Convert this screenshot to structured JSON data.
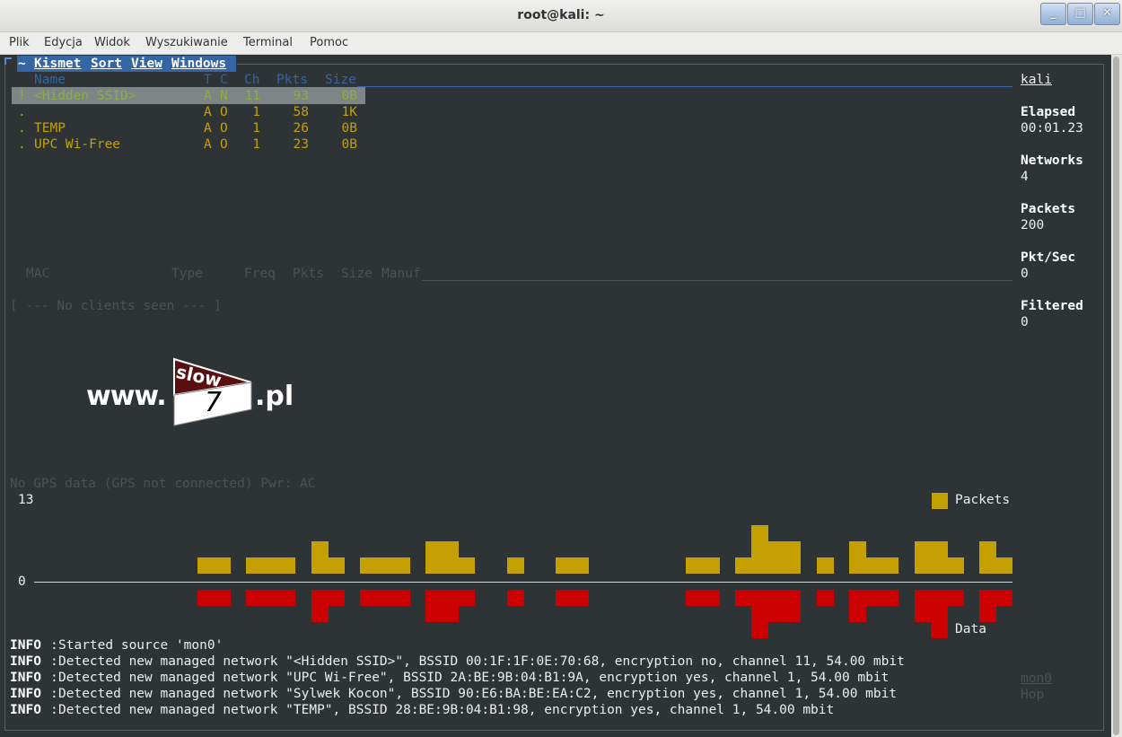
{
  "window": {
    "title": "root@kali: ~",
    "buttons": [
      "_",
      "□",
      "✕"
    ]
  },
  "menubar": [
    "Plik",
    "Edycja",
    "Widok",
    "Wyszukiwanie",
    "Terminal",
    "Pomoc"
  ],
  "kismet_menu": {
    "prefix": "~",
    "items": [
      "Kismet",
      "Sort",
      "View",
      "Windows"
    ]
  },
  "network_list": {
    "headers": [
      "Name",
      "T",
      "C",
      "Ch",
      "Pkts",
      "Size"
    ],
    "rows": [
      {
        "flag": "!",
        "name": "<Hidden SSID>",
        "t": "A",
        "c": "N",
        "ch": "11",
        "pkts": "93",
        "size": "0B"
      },
      {
        "flag": ".",
        "name": "",
        "t": "A",
        "c": "O",
        "ch": "1",
        "pkts": "58",
        "size": "1K"
      },
      {
        "flag": ".",
        "name": "TEMP",
        "t": "A",
        "c": "O",
        "ch": "1",
        "pkts": "26",
        "size": "0B"
      },
      {
        "flag": ".",
        "name": "UPC Wi-Free",
        "t": "A",
        "c": "O",
        "ch": "1",
        "pkts": "23",
        "size": "0B"
      }
    ]
  },
  "client_list": {
    "headers": [
      "MAC",
      "Type",
      "Freq",
      "Pkts",
      "Size",
      "Manuf"
    ],
    "empty": "[ --- No clients seen --- ]"
  },
  "watermark": {
    "prefix": "www.",
    "logo_top": "slow",
    "logo_num": "7",
    "suffix": ".pl"
  },
  "gps_status": "No GPS data (GPS not connected) Pwr: AC",
  "graph": {
    "ymax_label": "13",
    "zero_label": "0",
    "legend_packets": "Packets",
    "legend_data": "Data",
    "colors": {
      "packets": "#c4a000",
      "data": "#cc0000"
    },
    "packets_levels": [
      0,
      0,
      0,
      0,
      0,
      0,
      0,
      0,
      0,
      0,
      1,
      1,
      0,
      1,
      1,
      1,
      0,
      2,
      1,
      0,
      1,
      1,
      1,
      0,
      2,
      2,
      1,
      0,
      0,
      1,
      0,
      0,
      1,
      1,
      0,
      0,
      0,
      0,
      0,
      0,
      1,
      1,
      0,
      1,
      3,
      2,
      2,
      0,
      1,
      0,
      2,
      1,
      1,
      0,
      2,
      2,
      1,
      0,
      2,
      1
    ],
    "data_levels": [
      0,
      0,
      0,
      0,
      0,
      0,
      0,
      0,
      0,
      0,
      1,
      1,
      0,
      1,
      1,
      1,
      0,
      2,
      1,
      0,
      1,
      1,
      1,
      0,
      2,
      2,
      1,
      0,
      0,
      1,
      0,
      0,
      1,
      1,
      0,
      0,
      0,
      0,
      0,
      0,
      1,
      1,
      0,
      1,
      3,
      2,
      2,
      0,
      1,
      0,
      2,
      1,
      1,
      0,
      2,
      3,
      1,
      0,
      2,
      1
    ]
  },
  "log": {
    "label": "INFO",
    "lines": [
      "Started source 'mon0'",
      "Detected new managed network \"<Hidden SSID>\", BSSID 00:1F:1F:0E:70:68, encryption no, channel 11, 54.00 mbit",
      "Detected new managed network \"UPC Wi-Free\", BSSID 2A:BE:9B:04:B1:9A, encryption yes, channel 1, 54.00 mbit",
      "Detected new managed network \"Sylwek Kocon\", BSSID 90:E6:BA:BE:EA:C2, encryption yes, channel 1, 54.00 mbit",
      "Detected new managed network \"TEMP\", BSSID 28:BE:9B:04:B1:98, encryption yes, channel 1, 54.00 mbit"
    ]
  },
  "info_panel": {
    "host": "kali",
    "stats": [
      {
        "label": "Elapsed",
        "value": "00:01.23"
      },
      {
        "label": "Networks",
        "value": "4"
      },
      {
        "label": "Packets",
        "value": "200"
      },
      {
        "label": "Pkt/Sec",
        "value": "0"
      },
      {
        "label": "Filtered",
        "value": "0"
      }
    ],
    "source": "mon0",
    "source_status": "Hop"
  }
}
